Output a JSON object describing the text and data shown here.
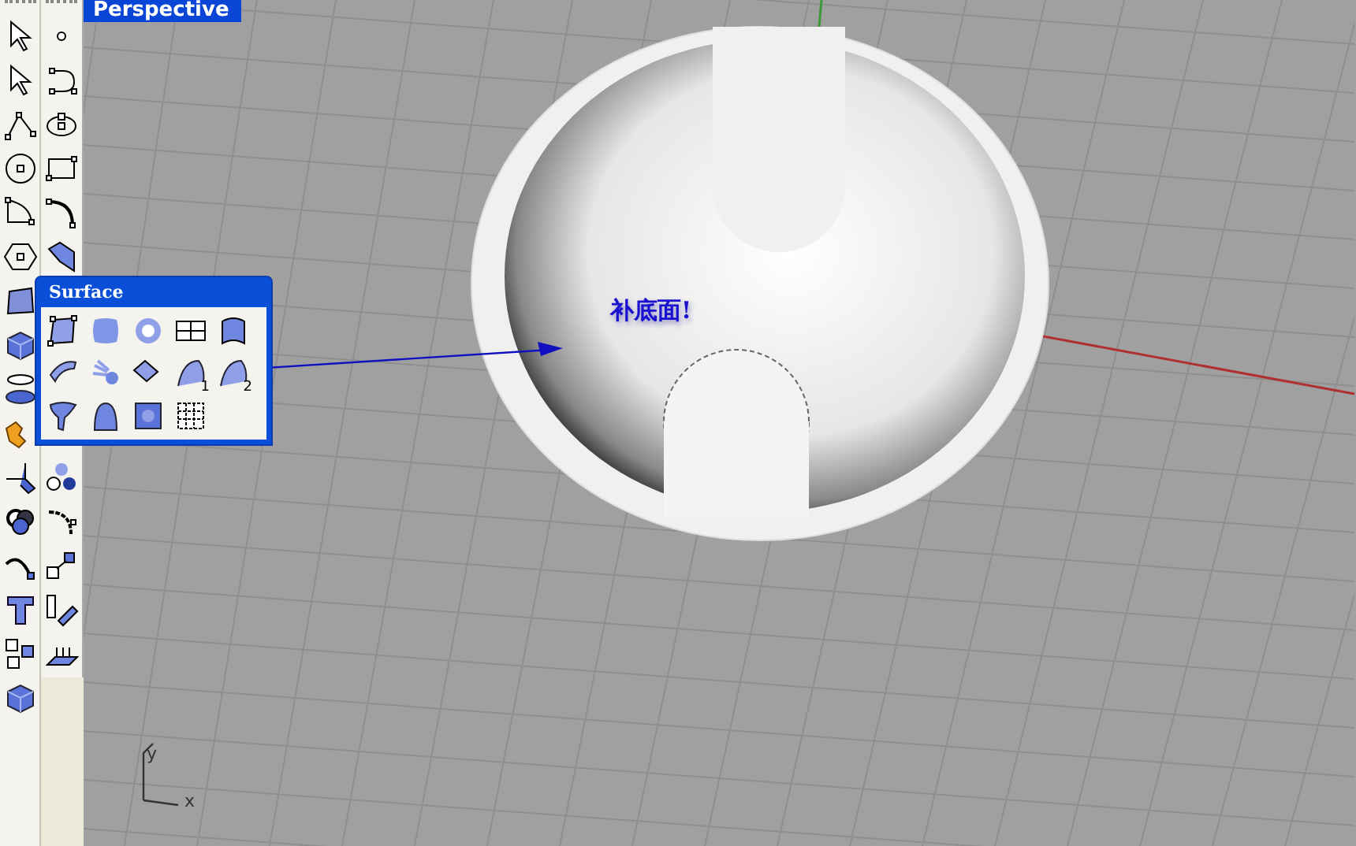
{
  "viewport": {
    "title": "Perspective",
    "annotation": "补底面!",
    "axis": {
      "x_label": "x",
      "y_label": "y"
    }
  },
  "surface_palette": {
    "title": "Surface",
    "tool_labels": [
      "1",
      "2"
    ]
  }
}
